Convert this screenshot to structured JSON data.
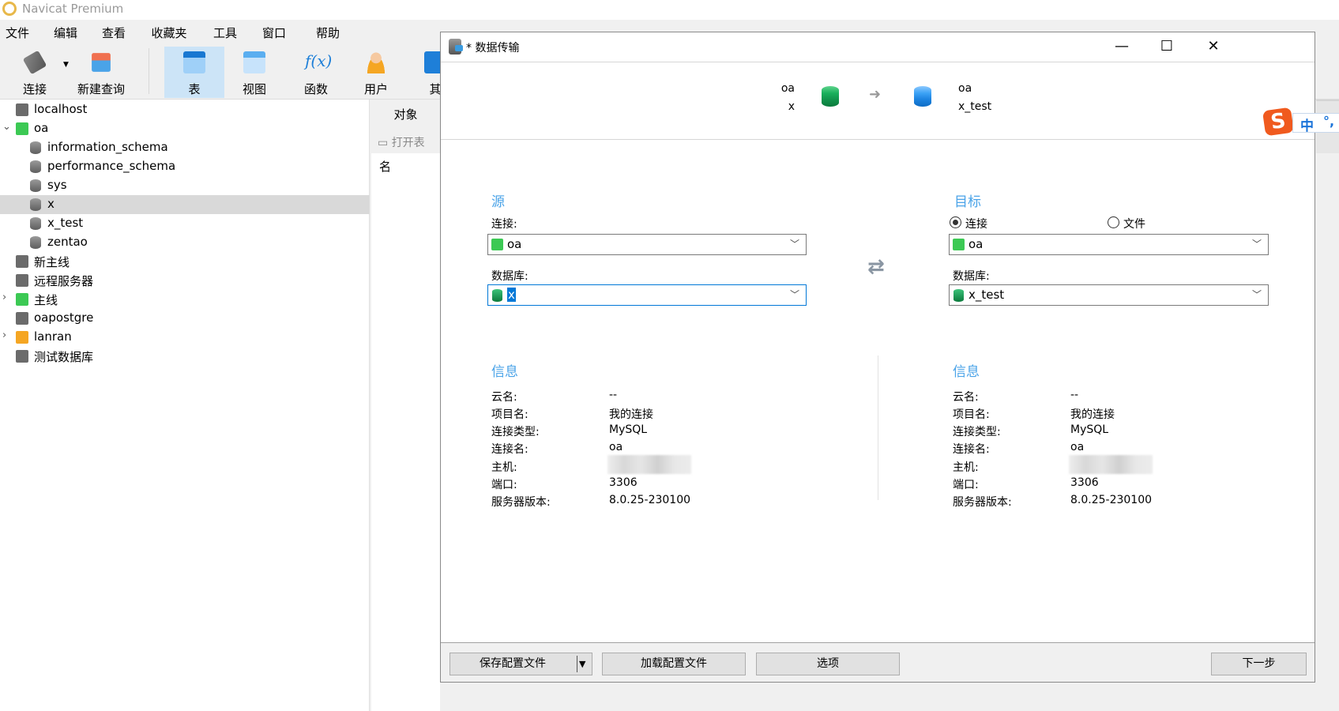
{
  "app": {
    "title": "Navicat Premium"
  },
  "menu": [
    "文件",
    "编辑",
    "查看",
    "收藏夹",
    "工具",
    "窗口",
    "帮助"
  ],
  "toolbar": {
    "connect": "连接",
    "new_query": "新建查询",
    "table": "表",
    "view": "视图",
    "function": "函数",
    "user": "用户",
    "other": "其"
  },
  "tree": [
    {
      "label": "localhost",
      "type": "connection",
      "color": "#6b6b6b"
    },
    {
      "label": "oa",
      "type": "connection",
      "color": "#3cc954",
      "expanded": true
    },
    {
      "label": "information_schema",
      "type": "database"
    },
    {
      "label": "performance_schema",
      "type": "database"
    },
    {
      "label": "sys",
      "type": "database"
    },
    {
      "label": "x",
      "type": "database",
      "selected": true
    },
    {
      "label": "x_test",
      "type": "database"
    },
    {
      "label": "zentao",
      "type": "database"
    },
    {
      "label": "新主线",
      "type": "connection",
      "color": "#6b6b6b"
    },
    {
      "label": "远程服务器",
      "type": "connection",
      "color": "#6b6b6b"
    },
    {
      "label": "主线",
      "type": "connection",
      "color": "#3cc954",
      "collapsed": true
    },
    {
      "label": "oapostgre",
      "type": "connection",
      "color": "#6b6b6b"
    },
    {
      "label": "lanran",
      "type": "connection",
      "color": "#f5a623",
      "collapsed": true
    },
    {
      "label": "测试数据库",
      "type": "connection",
      "color": "#6b6b6b"
    }
  ],
  "objects_panel": {
    "tab": "对象",
    "open_table": "打开表",
    "name_col": "名"
  },
  "dialog": {
    "title": "* 数据传输",
    "header": {
      "src_conn": "oa",
      "src_db": "x",
      "dst_conn": "oa",
      "dst_db": "x_test"
    },
    "source": {
      "heading": "源",
      "conn_label": "连接:",
      "conn_value": "oa",
      "db_label": "数据库:",
      "db_value": "x"
    },
    "target": {
      "heading": "目标",
      "radio_conn": "连接",
      "radio_file": "文件",
      "selected": "连接",
      "conn_value": "oa",
      "db_label": "数据库:",
      "db_value": "x_test"
    },
    "info_heading": "信息",
    "info_labels": [
      "云名:",
      "项目名:",
      "连接类型:",
      "连接名:",
      "主机:",
      "端口:",
      "服务器版本:"
    ],
    "source_info": [
      "--",
      "我的连接",
      "MySQL",
      "oa",
      "",
      "3306",
      "8.0.25-230100"
    ],
    "target_info": [
      "--",
      "我的连接",
      "MySQL",
      "oa",
      "",
      "3306",
      "8.0.25-230100"
    ],
    "buttons": {
      "save_profile": "保存配置文件",
      "load_profile": "加载配置文件",
      "options": "选项",
      "next": "下一步"
    }
  },
  "ime": {
    "mode": "中",
    "punct": "°,"
  },
  "colors": {
    "accent": "#4aa3e8",
    "selection": "#0078d7",
    "toolbar_selected": "#cce4f7"
  }
}
